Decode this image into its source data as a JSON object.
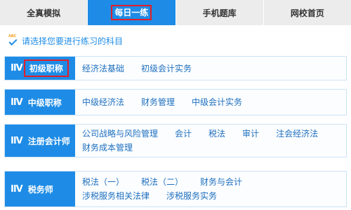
{
  "tabs": [
    {
      "label": "全真模拟"
    },
    {
      "label": "每日一练"
    },
    {
      "label": "手机题库"
    },
    {
      "label": "网校首页"
    }
  ],
  "prompt": {
    "icon_text": "ABC",
    "text": "请选择您要进行练习的科目"
  },
  "rows": [
    {
      "icon": "IIV",
      "title": "初级职称",
      "items": [
        "经济法基础",
        "初级会计实务"
      ]
    },
    {
      "icon": "IIV",
      "title": "中级职称",
      "items": [
        "中级经济法",
        "财务管理",
        "中级会计实务"
      ]
    },
    {
      "icon": "IIV",
      "title": "注册会计师",
      "items": [
        "公司战略与风险管理",
        "会计",
        "税法",
        "审计",
        "注会经济法",
        "财务成本管理"
      ]
    },
    {
      "icon": "IIV",
      "title": "税务师",
      "items": [
        "税法（一）",
        "税法（二）",
        "财务与会计",
        "涉税服务相关法律",
        "涉税服务实务"
      ]
    }
  ],
  "colors": {
    "accent": "#1e8ce6",
    "tab_inactive": "#ececec",
    "highlight_box": "#e0202a",
    "link": "#1e6fbe"
  }
}
